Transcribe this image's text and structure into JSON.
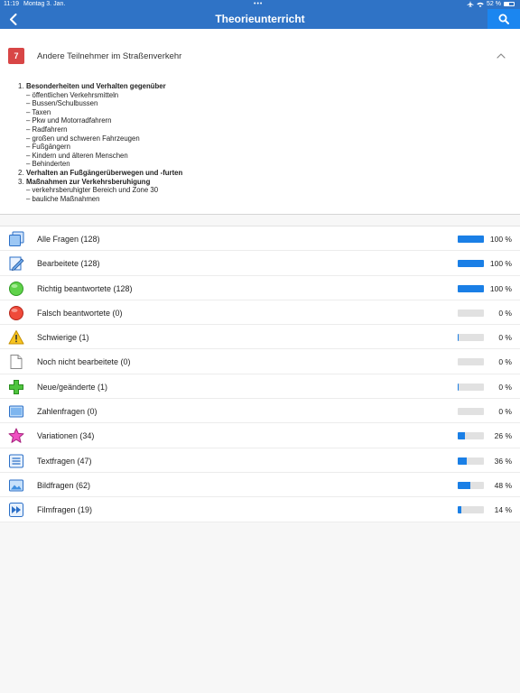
{
  "status_bar": {
    "time": "11:19",
    "date": "Montag 3. Jan.",
    "dots": "•••",
    "battery_percent": "52 %",
    "icons": [
      "airplane-icon",
      "wifi-icon",
      "battery-icon"
    ]
  },
  "nav": {
    "title": "Theorieunterricht",
    "back_icon": "chevron-left-icon",
    "search_icon": "search-icon"
  },
  "chapter": {
    "number": "7",
    "title": "Andere Teilnehmer im Straßenverkehr",
    "badge_color": "#d84646",
    "topics": [
      {
        "num": "1.",
        "label": "Besonderheiten und Verhalten gegenüber",
        "subs": [
          "– öffentlichen Verkehrsmitteln",
          "– Bussen/Schulbussen",
          "– Taxen",
          "– Pkw und Motorradfahrern",
          "– Radfahrern",
          "– großen und schweren Fahrzeugen",
          "– Fußgängern",
          "– Kindern und älteren Menschen",
          "– Behinderten"
        ]
      },
      {
        "num": "2.",
        "label": "Verhalten an Fußgängerüberwegen und -furten",
        "subs": []
      },
      {
        "num": "3.",
        "label": "Maßnahmen zur Verkehrsberuhigung",
        "subs": [
          "– verkehrsberuhigter Bereich und Zone 30",
          "– bauliche Maßnahmen"
        ]
      }
    ]
  },
  "stats": [
    {
      "label": "Alle Fragen (128)",
      "percent": "100 %",
      "fill": 1.0,
      "icon": "stack-icon"
    },
    {
      "label": "Bearbeitete (128)",
      "percent": "100 %",
      "fill": 1.0,
      "icon": "edit-document-icon"
    },
    {
      "label": "Richtig beantwortete (128)",
      "percent": "100 %",
      "fill": 1.0,
      "icon": "green-circle-icon"
    },
    {
      "label": "Falsch beantwortete (0)",
      "percent": "0 %",
      "fill": 0.0,
      "icon": "red-circle-icon"
    },
    {
      "label": "Schwierige (1)",
      "percent": "0 %",
      "fill": 0.03,
      "icon": "warning-icon"
    },
    {
      "label": "Noch nicht bearbeitete (0)",
      "percent": "0 %",
      "fill": 0.0,
      "icon": "blank-document-icon"
    },
    {
      "label": "Neue/geänderte (1)",
      "percent": "0 %",
      "fill": 0.03,
      "icon": "green-plus-icon"
    },
    {
      "label": "Zahlenfragen (0)",
      "percent": "0 %",
      "fill": 0.0,
      "icon": "number-box-icon"
    },
    {
      "label": "Variationen (34)",
      "percent": "26 %",
      "fill": 0.26,
      "icon": "pink-star-icon"
    },
    {
      "label": "Textfragen (47)",
      "percent": "36 %",
      "fill": 0.36,
      "icon": "text-lines-icon"
    },
    {
      "label": "Bildfragen (62)",
      "percent": "48 %",
      "fill": 0.48,
      "icon": "picture-icon"
    },
    {
      "label": "Filmfragen (19)",
      "percent": "14 %",
      "fill": 0.14,
      "icon": "fast-forward-icon"
    }
  ],
  "colors": {
    "header": "#2f73c6",
    "search_button": "#1b86f0",
    "bar_fill": "#1a7fe6",
    "bar_track": "#e1e1e1"
  }
}
